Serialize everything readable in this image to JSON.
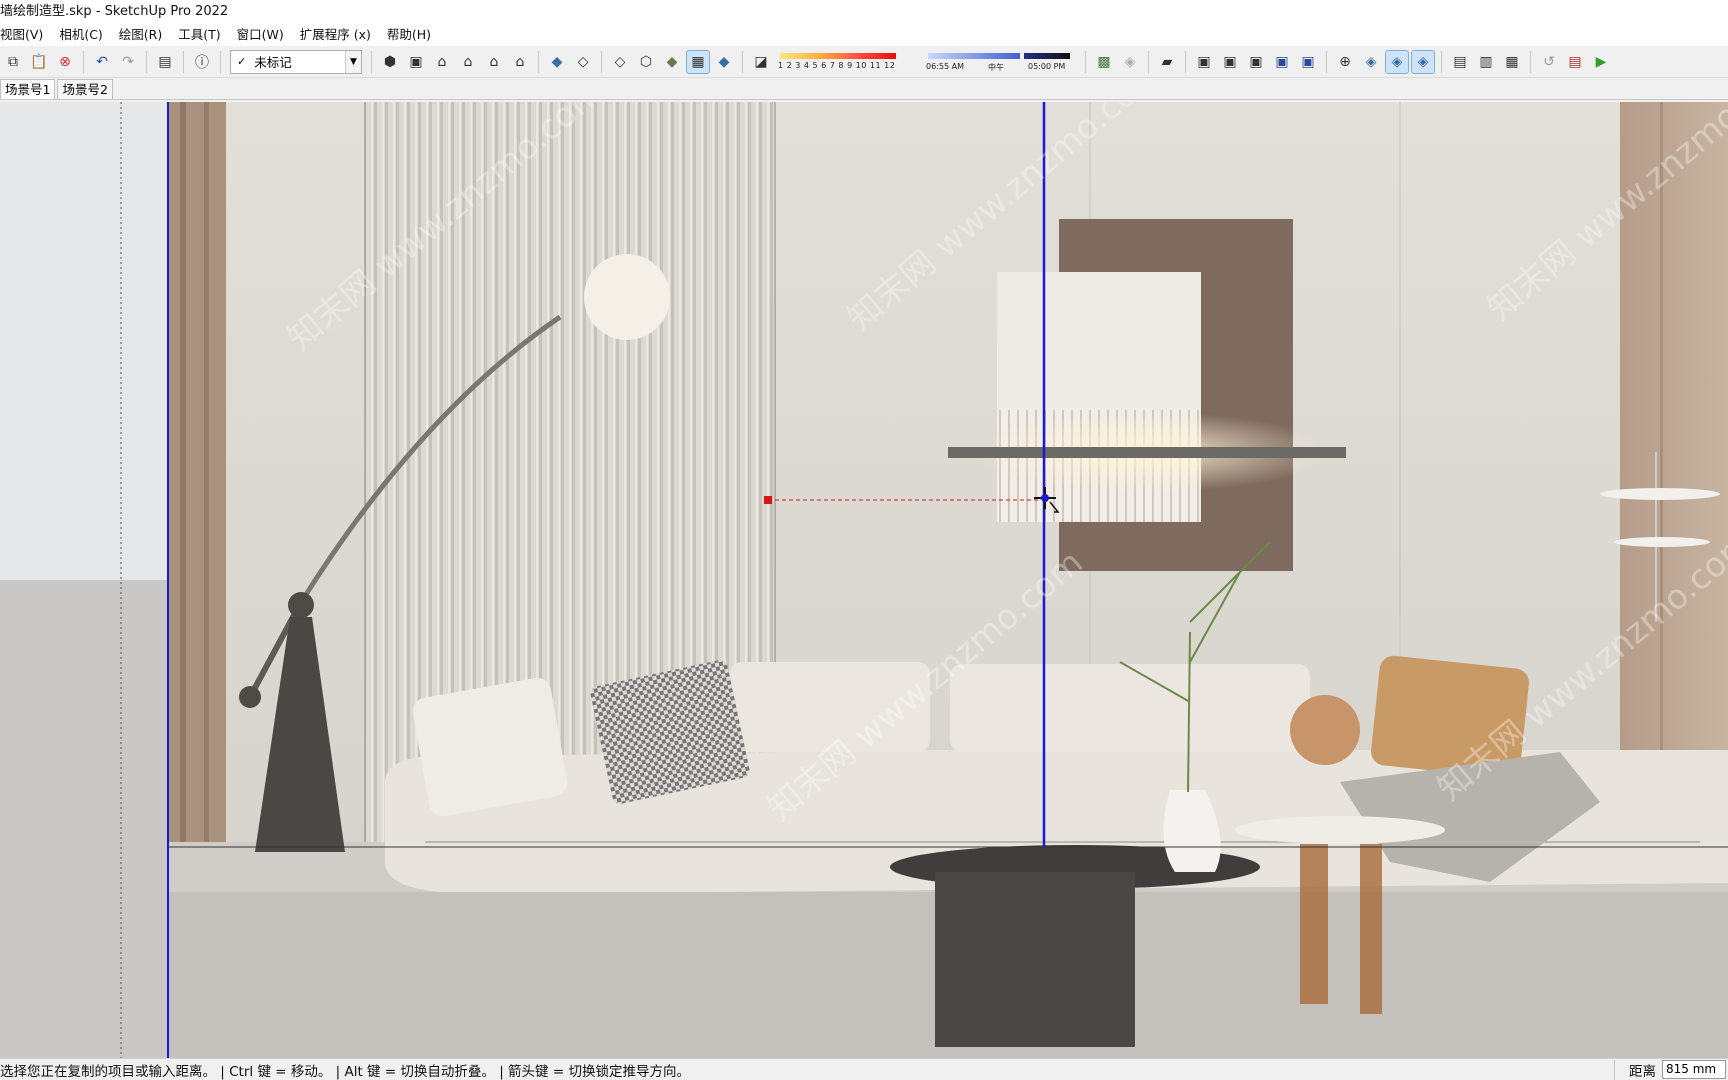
{
  "window": {
    "title": "墙绘制造型.skp - SketchUp Pro 2022"
  },
  "menu": [
    "视图(V)",
    "相机(C)",
    "绘图(R)",
    "工具(T)",
    "窗口(W)",
    "扩展程序 (x)",
    "帮助(H)"
  ],
  "toolbar": {
    "tag_select": {
      "value": "未标记"
    },
    "shadow_months": "1 2 3 4 5 6 7 8 9 10 11 12",
    "time_start": "06:55 AM",
    "time_mid": "中午",
    "time_end": "05:00 PM",
    "icons": [
      "copy-icon",
      "paste-icon",
      "erase-icon",
      "undo-icon",
      "redo-icon",
      "print-icon",
      "model-info-icon",
      "iso-view-icon",
      "top-view-icon",
      "front-view-icon",
      "right-view-icon",
      "back-view-icon",
      "left-view-icon",
      "xray-icon",
      "backedges-icon",
      "wireframe-icon",
      "hiddenline-icon",
      "shaded-icon",
      "shaded-textures-icon",
      "monochrome-icon",
      "shadows-toggle-icon",
      "warehouse-icon",
      "extension-warehouse-icon",
      "layout-icon",
      "solid-outer-icon",
      "solid-intersect-icon",
      "solid-union-icon",
      "solid-subtract-icon",
      "solid-trim-icon",
      "section-plane-icon",
      "section-display-icon",
      "section-cut-icon",
      "section-fill-icon",
      "outliner-icon",
      "styles-icon",
      "components-icon",
      "undo-history-icon",
      "report-icon",
      "run-icon"
    ]
  },
  "scenes": [
    "场景号1",
    "场景号2"
  ],
  "status": {
    "hint": "选择您正在复制的项目或输入距离。 | Ctrl 键 = 移动。 | Alt 键 = 切换自动折叠。 | 箭头键 = 切换锁定推导方向。",
    "measure_label": "距离",
    "measure_value": "815 mm"
  },
  "watermark": "知末网 www.znzmo.com",
  "colors": {
    "axis_blue": "#1a1ad0",
    "inference_red": "#d01818",
    "wall": "#dcd8d2",
    "sofa": "#e8e4dd",
    "art_brown": "#7e6a5e"
  }
}
